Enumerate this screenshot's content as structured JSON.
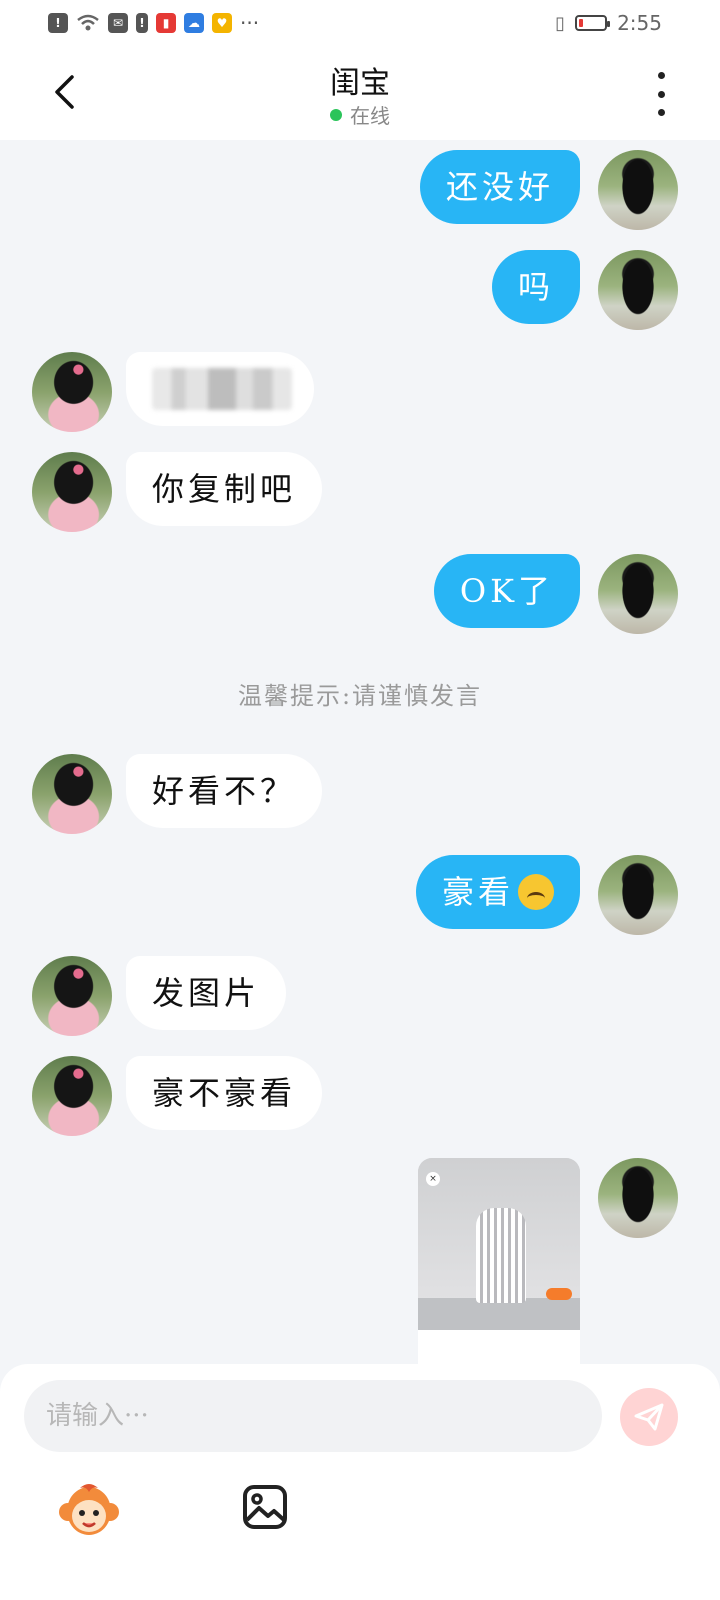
{
  "statusbar": {
    "time": "2:55",
    "dots": "···"
  },
  "header": {
    "title": "闺宝",
    "status": "在线"
  },
  "messages": [
    {
      "side": "out",
      "text": "还没好"
    },
    {
      "side": "out",
      "text": "吗"
    },
    {
      "side": "in",
      "text": ""
    },
    {
      "side": "in",
      "text": "你复制吧"
    },
    {
      "side": "out",
      "text": "OK了"
    },
    {
      "side": "in",
      "text": "好看不？"
    },
    {
      "side": "out",
      "text": "豪看"
    },
    {
      "side": "in",
      "text": "发图片"
    },
    {
      "side": "in",
      "text": "豪不豪看"
    }
  ],
  "notice": "温馨提示:请谨慎发言",
  "composer": {
    "placeholder": "请输入···"
  },
  "colors": {
    "outgoing_bubble": "#28b5f5",
    "incoming_bubble": "#ffffff",
    "online_dot": "#2bc45a"
  }
}
